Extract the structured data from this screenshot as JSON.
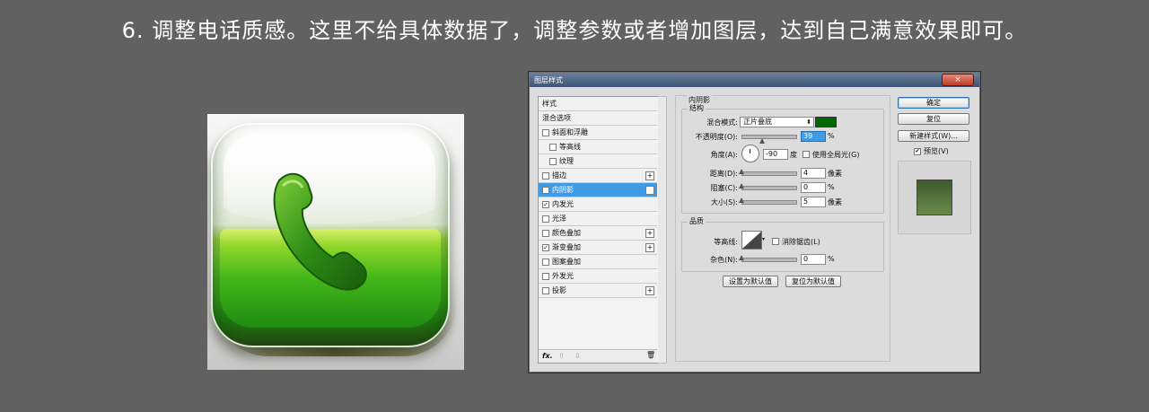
{
  "caption": "6. 调整电话质感。这里不给具体数据了，调整参数或者增加图层，达到自己满意效果即可。",
  "dialog": {
    "title": "图层样式",
    "close_glyph": "×",
    "styles_list": [
      {
        "label": "样式",
        "checkbox": false,
        "checked": false,
        "plus": false,
        "indent": false,
        "selected": false
      },
      {
        "label": "混合选项",
        "checkbox": false,
        "checked": false,
        "plus": false,
        "indent": false,
        "selected": false
      },
      {
        "label": "斜面和浮雕",
        "checkbox": true,
        "checked": false,
        "plus": false,
        "indent": false,
        "selected": false
      },
      {
        "label": "等高线",
        "checkbox": true,
        "checked": false,
        "plus": false,
        "indent": true,
        "selected": false
      },
      {
        "label": "纹理",
        "checkbox": true,
        "checked": false,
        "plus": false,
        "indent": true,
        "selected": false
      },
      {
        "label": "描边",
        "checkbox": true,
        "checked": false,
        "plus": true,
        "indent": false,
        "selected": false
      },
      {
        "label": "内阴影",
        "checkbox": true,
        "checked": true,
        "plus": true,
        "indent": false,
        "selected": true
      },
      {
        "label": "内发光",
        "checkbox": true,
        "checked": true,
        "plus": false,
        "indent": false,
        "selected": false
      },
      {
        "label": "光泽",
        "checkbox": true,
        "checked": false,
        "plus": false,
        "indent": false,
        "selected": false
      },
      {
        "label": "颜色叠加",
        "checkbox": true,
        "checked": false,
        "plus": true,
        "indent": false,
        "selected": false
      },
      {
        "label": "渐变叠加",
        "checkbox": true,
        "checked": true,
        "plus": true,
        "indent": false,
        "selected": false
      },
      {
        "label": "图案叠加",
        "checkbox": true,
        "checked": false,
        "plus": false,
        "indent": false,
        "selected": false
      },
      {
        "label": "外发光",
        "checkbox": true,
        "checked": false,
        "plus": false,
        "indent": false,
        "selected": false
      },
      {
        "label": "投影",
        "checkbox": true,
        "checked": false,
        "plus": true,
        "indent": false,
        "selected": false
      }
    ],
    "footer": {
      "fx": "fx.",
      "up": "⇧",
      "down": "⇩",
      "trash": "🗑"
    },
    "panel": {
      "section_title": "内阴影",
      "structure_title": "结构",
      "blend_mode_label": "混合模式:",
      "blend_mode_value": "正片叠底",
      "blend_color": "#006a00",
      "opacity_label": "不透明度(O):",
      "opacity_value": "39",
      "opacity_unit": "%",
      "opacity_fraction": 0.39,
      "angle_label": "角度(A):",
      "angle_value": "-90",
      "angle_unit": "度",
      "global_light_label": "使用全局光(G)",
      "distance_label": "距离(D):",
      "distance_value": "4",
      "distance_unit": "像素",
      "choke_label": "阻塞(C):",
      "choke_value": "0",
      "choke_unit": "%",
      "size_label": "大小(S):",
      "size_value": "5",
      "size_unit": "像素",
      "quality_title": "品质",
      "contour_label": "等高线:",
      "antialias_label": "消除锯齿(L)",
      "noise_label": "杂色(N):",
      "noise_value": "0",
      "noise_unit": "%",
      "make_default": "设置为默认值",
      "reset_default": "复位为默认值"
    },
    "buttons": {
      "ok": "确定",
      "reset": "复位",
      "new_style": "新建样式(W)...",
      "preview_label": "预览(V)",
      "preview_checked": true,
      "preview_check_glyph": "✔"
    }
  }
}
